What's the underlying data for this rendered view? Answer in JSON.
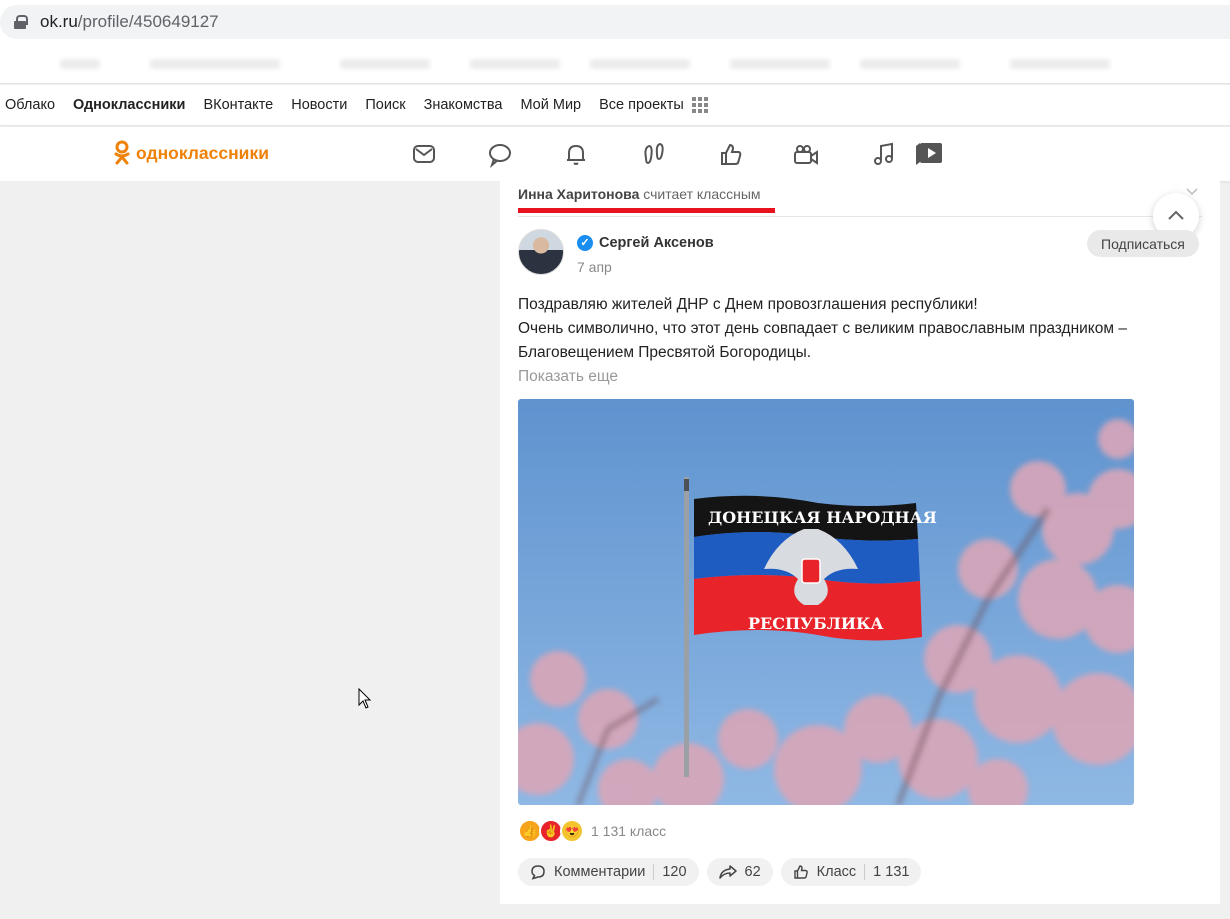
{
  "browser": {
    "url_host": "ok.ru",
    "url_path": "/profile/450649127"
  },
  "portal_nav": {
    "items": [
      "Облако",
      "Одноклассники",
      "ВКонтакте",
      "Новости",
      "Поиск",
      "Знакомства",
      "Мой Мир",
      "Все проекты"
    ],
    "active": "Одноклассники"
  },
  "toolbar": {
    "logo_text": "одноклассники",
    "logo_color": "#ee8208",
    "icons": [
      "messages-icon",
      "discussions-icon",
      "notifications-icon",
      "guests-icon",
      "likes-icon",
      "video-icon",
      "music-icon",
      "video-play-icon"
    ]
  },
  "feed": {
    "activity_user": "Инна Харитонова",
    "activity_text": "считает классным",
    "post": {
      "author": "Сергей Аксенов",
      "date": "7 апр",
      "subscribe_label": "Подписаться",
      "text_lines": [
        "Поздравляю жителей ДНР с Днем провозглашения республики!",
        "Очень символично, что этот день совпадает с великим православным праздником –",
        "Благовещением Пресвятой Богородицы."
      ],
      "show_more": "Показать еще",
      "flag_text_top": "ДОНЕЦКАЯ НАРОДНАЯ",
      "flag_text_bottom": "РЕСПУБЛИКА",
      "reactions_count": "1 131 класс",
      "actions": {
        "comments_label": "Комментарии",
        "comments_count": "120",
        "shares_count": "62",
        "like_label": "Класс",
        "like_count": "1 131"
      }
    }
  },
  "colors": {
    "accent_red": "#e8131f",
    "verified_blue": "#1a8ef0"
  }
}
